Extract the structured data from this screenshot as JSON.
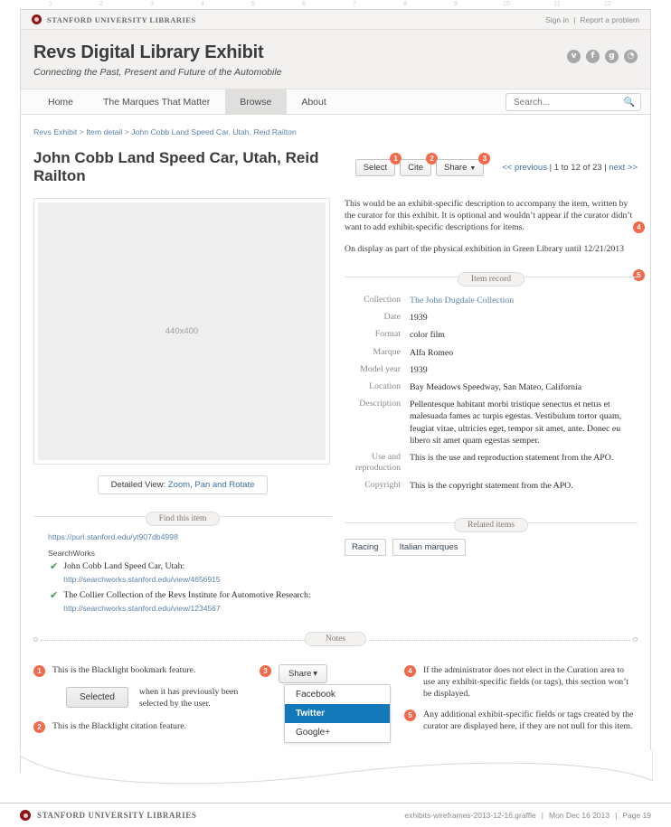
{
  "ruler": {
    "ticks": [
      "1",
      "2",
      "3",
      "4",
      "5",
      "6",
      "7",
      "8",
      "9",
      "10",
      "11",
      "12"
    ]
  },
  "sul_bar": {
    "org": "STANFORD UNIVERSITY LIBRARIES",
    "sign_in": "Sign in",
    "separator": "|",
    "report": "Report a problem"
  },
  "masthead": {
    "title": "Revs Digital Library Exhibit",
    "subtitle": "Connecting the Past, Present and Future of the Automobile",
    "social": [
      {
        "name": "twitter-icon",
        "glyph": "ᴠ"
      },
      {
        "name": "facebook-icon",
        "glyph": "f"
      },
      {
        "name": "googleplus-icon",
        "glyph": "g"
      },
      {
        "name": "rss-icon",
        "glyph": "◔"
      }
    ]
  },
  "nav": {
    "tabs": [
      {
        "label": "Home",
        "active": false
      },
      {
        "label": "The Marques That Matter",
        "active": false
      },
      {
        "label": "Browse",
        "active": true
      },
      {
        "label": "About",
        "active": false
      }
    ],
    "search": {
      "placeholder": "Search...",
      "value": "",
      "icon": "search-icon"
    }
  },
  "breadcrumb": {
    "items": [
      "Revs Exhibit",
      "Item detail",
      "John Cobb Land Speed Car, Utah, Reid Railton"
    ],
    "separator": ">"
  },
  "item": {
    "title": "John Cobb Land Speed Car, Utah, Reid Railton",
    "buttons": [
      {
        "label": "Select",
        "badge": "1",
        "caret": false
      },
      {
        "label": "Cite",
        "badge": "2",
        "caret": false
      },
      {
        "label": "Share",
        "badge": "3",
        "caret": true
      }
    ],
    "pager": {
      "previous": "<< previous",
      "sep1": "|",
      "range": "1 to 12 of 23",
      "sep2": "|",
      "next": "next >>"
    }
  },
  "image": {
    "placeholder": "440x400",
    "detailed_view_label": "Detailed View:",
    "detailed_view_link": "Zoom, Pan and Rotate"
  },
  "exhibit_description": {
    "paragraph1": "This would be an exhibit-specific description to accompany the item, written by the curator for this exhibit. It is optional and wouldn’t appear if the curator didn’t want to add exhibit-specific descriptions for items.",
    "paragraph2": "On display as part of the physical exhibition in Green Library until 12/21/2013",
    "badge4": "4",
    "badge5": "5"
  },
  "item_record": {
    "heading": "Item record",
    "rows": [
      {
        "key": "Collection",
        "value": "The John Dugdale Collection",
        "is_link": true
      },
      {
        "key": "Date",
        "value": "1939",
        "is_link": false
      },
      {
        "key": "Format",
        "value": "color film",
        "is_link": false
      },
      {
        "key": "Marque",
        "value": "Alfa Romeo",
        "is_link": false
      },
      {
        "key": "Model year",
        "value": "1939",
        "is_link": false
      },
      {
        "key": "Location",
        "value": "Bay Meadows Speedway, San Mateo, California",
        "is_link": false
      },
      {
        "key": "Description",
        "value": "Pellentesque habitant morbi tristique senectus et netus et malesuada fames ac turpis egestas. Vestibulum tortor quam, feugiat vitae, ultricies eget, tempor sit amet, ante. Donec eu libero sit amet quam egestas semper.",
        "is_link": false
      },
      {
        "key": "Use and reproduction",
        "value": "This is the use and reproduction statement from the APO.",
        "is_link": false
      },
      {
        "key": "Copyright",
        "value": "This is the copyright statement from the APO.",
        "is_link": false
      }
    ]
  },
  "find_this_item": {
    "heading": "Find this item",
    "purl": "https://purl.stanford.edu/yt907db4998",
    "searchworks_label": "SearchWorks",
    "entries": [
      {
        "title": "John Cobb Land Speed Car, Utah:",
        "url": "http://searchworks.stanford.edu/view/4656915"
      },
      {
        "title": "The Collier Collection of the Revs Institute for Automotive Research:",
        "url": "http://searchworks.stanford.edu/view/1234567"
      }
    ]
  },
  "related_items": {
    "heading": "Related items",
    "tags": [
      "Racing",
      "Italian marques"
    ]
  },
  "notes": {
    "heading": "Notes",
    "left": [
      {
        "badge": "1",
        "text": "This is the Blacklight bookmark feature."
      },
      {
        "badge": "2",
        "text": "This is the Blacklight citation feature."
      }
    ],
    "selected_button": "Selected",
    "selected_caption": "when it has previously been selected by the user.",
    "share": {
      "badge": "3",
      "button_label": "Share",
      "caret": "▾",
      "options": [
        {
          "label": "Facebook",
          "selected": false
        },
        {
          "label": "Twitter",
          "selected": true
        },
        {
          "label": "Google+",
          "selected": false
        }
      ]
    },
    "right": [
      {
        "badge": "4",
        "text": "If the administrator does not elect in the Curation area to use any exhibit-specific fields (or tags), this section won’t be displayed."
      },
      {
        "badge": "5",
        "text": "Any additional exhibit-specific fields or tags created by the curator are displayed here, if they are not null for this item."
      }
    ]
  },
  "footer": {
    "org": "STANFORD UNIVERSITY LIBRARIES",
    "file": "exhibits-wireframes-2013-12-16.graffle",
    "sep1": "|",
    "date": "Mon Dec 16 2013",
    "sep2": "|",
    "page": "Page 19"
  },
  "colors": {
    "accent_badge": "#f26a4b",
    "link": "#5b83ad",
    "highlight": "#1379b8",
    "stanford_red": "#8c1515",
    "check_green": "#3f9b52"
  }
}
